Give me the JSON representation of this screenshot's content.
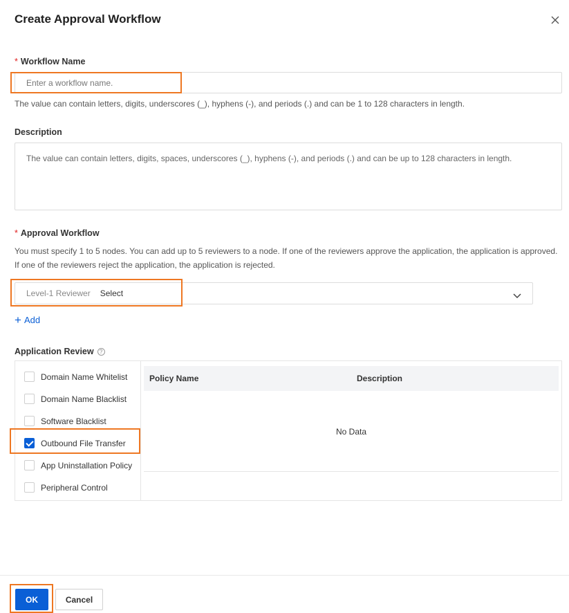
{
  "dialog": {
    "title": "Create Approval Workflow"
  },
  "workflow_name": {
    "label": "Workflow Name",
    "required_mark": "*",
    "placeholder": "Enter a workflow name.",
    "value": "",
    "hint": "The value can contain letters, digits, underscores (_), hyphens (-), and periods (.) and can be 1 to 128 characters in length."
  },
  "description": {
    "label": "Description",
    "placeholder": "The value can contain letters, digits, spaces, underscores (_), hyphens (-), and periods (.) and can be up to 128 characters in length.",
    "value": ""
  },
  "approval_workflow": {
    "label": "Approval Workflow",
    "required_mark": "*",
    "hint_line1": "You must specify 1 to 5 nodes. You can add up to 5 reviewers to a node. If one of the reviewers approve the application, the application is approved.",
    "hint_line2": "If one of the reviewers reject the application, the application is rejected.",
    "reviewer_prefix": "Level-1 Reviewer",
    "reviewer_value": "Select",
    "add_label": "Add"
  },
  "application_review": {
    "label": "Application Review",
    "help_glyph": "?",
    "items": [
      {
        "label": "Domain Name Whitelist",
        "checked": false
      },
      {
        "label": "Domain Name Blacklist",
        "checked": false
      },
      {
        "label": "Software Blacklist",
        "checked": false
      },
      {
        "label": "Outbound File Transfer",
        "checked": true
      },
      {
        "label": "App Uninstallation Policy",
        "checked": false
      },
      {
        "label": "Peripheral Control",
        "checked": false
      }
    ],
    "table": {
      "columns": [
        "Policy Name",
        "Description"
      ],
      "empty_text": "No Data"
    }
  },
  "footer": {
    "ok_label": "OK",
    "cancel_label": "Cancel"
  },
  "colors": {
    "primary": "#0a5fd6",
    "highlight": "#ee7722",
    "required": "#e02020"
  }
}
